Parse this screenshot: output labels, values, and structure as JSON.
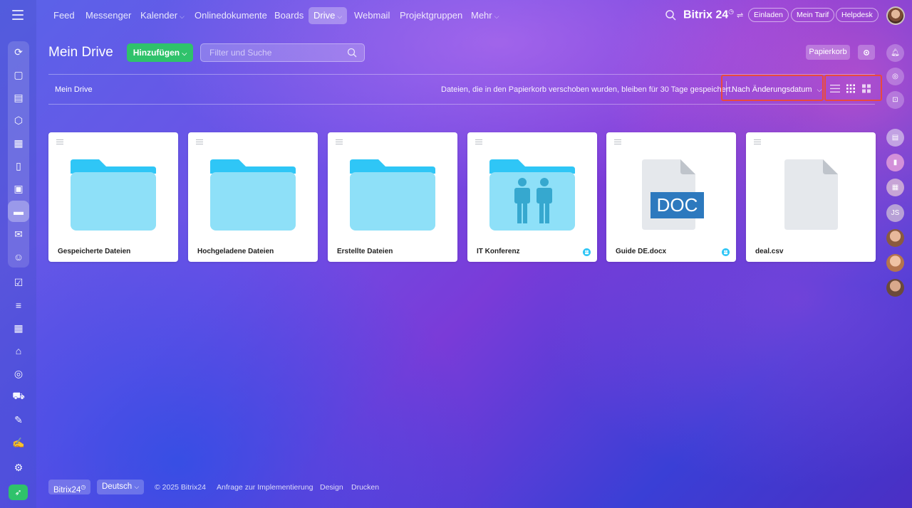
{
  "topnav": {
    "items": [
      {
        "label": "Feed",
        "has_caret": false
      },
      {
        "label": "Messenger",
        "has_caret": false
      },
      {
        "label": "Kalender",
        "has_caret": true
      },
      {
        "label": "Onlinedokumente",
        "has_caret": false
      },
      {
        "label": "Boards",
        "has_caret": false
      },
      {
        "label": "Drive",
        "has_caret": true,
        "active": true
      },
      {
        "label": "Webmail",
        "has_caret": false
      },
      {
        "label": "Projektgruppen",
        "has_caret": false
      },
      {
        "label": "Mehr",
        "has_caret": true
      }
    ],
    "brand": "Bitrix 24",
    "invite_label": "Einladen",
    "plan_label": "Mein Tarif",
    "helpdesk_label": "Helpdesk"
  },
  "header": {
    "title": "Mein Drive",
    "add_label": "Hinzufügen",
    "search_placeholder": "Filter und Suche",
    "trash_label": "Papierkorb"
  },
  "toolbar": {
    "breadcrumb": "Mein Drive",
    "trash_note": "Dateien, die in den Papierkorb verschoben wurden, bleiben für 30 Tage gespeichert.",
    "sort_label": "Nach Änderungsdatum"
  },
  "files": [
    {
      "name": "Gespeicherte Dateien",
      "kind": "folder",
      "shared": false
    },
    {
      "name": "Hochgeladene Dateien",
      "kind": "folder",
      "shared": false
    },
    {
      "name": "Erstellte Dateien",
      "kind": "folder",
      "shared": false
    },
    {
      "name": "IT Konferenz",
      "kind": "group-folder",
      "shared": true
    },
    {
      "name": "Guide DE.docx",
      "kind": "doc",
      "doc_label": "DOC",
      "shared": true
    },
    {
      "name": "deal.csv",
      "kind": "file",
      "shared": false
    }
  ],
  "rightbar": {
    "initials": "JS"
  },
  "footer": {
    "brand": "Bitrix24",
    "language": "Deutsch",
    "copyright": "© 2025 Bitrix24",
    "links": [
      "Anfrage zur Implementierung",
      "Design",
      "Drucken"
    ]
  },
  "colors": {
    "accent_green": "#2fc26b",
    "highlight_red": "#ea4a3d",
    "folder_light": "#8ee0f8",
    "folder_dark": "#2fc6f6",
    "doc_blue": "#2d79be"
  }
}
